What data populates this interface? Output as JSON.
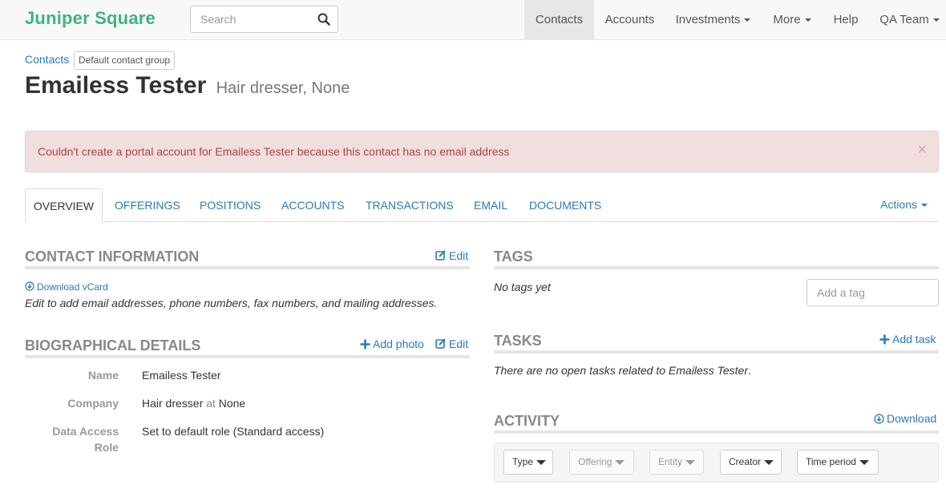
{
  "navbar": {
    "brand": "Juniper Square",
    "search_placeholder": "Search",
    "items": [
      {
        "label": "Contacts"
      },
      {
        "label": "Accounts"
      },
      {
        "label": "Investments"
      },
      {
        "label": "More"
      },
      {
        "label": "Help"
      },
      {
        "label": "QA Team"
      }
    ]
  },
  "breadcrumb": {
    "label": "Contacts",
    "group": "Default contact group"
  },
  "page": {
    "title": "Emailess Tester",
    "subtitle": "Hair dresser, None"
  },
  "alert": {
    "message": "Couldn't create a portal account for Emailess Tester because this contact has no email address",
    "close": "×"
  },
  "tabs": [
    {
      "label": "OVERVIEW"
    },
    {
      "label": "OFFERINGS"
    },
    {
      "label": "POSITIONS"
    },
    {
      "label": "ACCOUNTS"
    },
    {
      "label": "TRANSACTIONS"
    },
    {
      "label": "EMAIL"
    },
    {
      "label": "DOCUMENTS"
    }
  ],
  "actions_label": "Actions",
  "contact_info": {
    "title": "CONTACT INFORMATION",
    "edit": "Edit",
    "download_vcard": "Download vCard",
    "note": "Edit to add email addresses, phone numbers, fax numbers, and mailing addresses."
  },
  "bio": {
    "title": "BIOGRAPHICAL DETAILS",
    "add_photo": "Add photo",
    "edit": "Edit",
    "name_label": "Name",
    "name_value": "Emailess Tester",
    "company_label": "Company",
    "company_role": "Hair dresser",
    "company_at": "at",
    "company_name": "None",
    "role_label_1": "Data Access",
    "role_label_2": "Role",
    "role_value": "Set to default role (Standard access)"
  },
  "tags": {
    "title": "TAGS",
    "empty": "No tags yet",
    "input_placeholder": "Add a tag"
  },
  "tasks": {
    "title": "TASKS",
    "add": "Add task",
    "empty": "There are no open tasks related to Emailess Tester",
    "empty_end": "."
  },
  "activity": {
    "title": "ACTIVITY",
    "download": "Download",
    "filters": [
      {
        "label": "Type"
      },
      {
        "label": "Offering"
      },
      {
        "label": "Entity"
      },
      {
        "label": "Creator"
      },
      {
        "label": "Time period"
      }
    ]
  },
  "colors": {
    "brand": "#3fb27f",
    "link": "#2a7ab8",
    "alert_bg": "#f2dede",
    "alert_text": "#a94442"
  }
}
